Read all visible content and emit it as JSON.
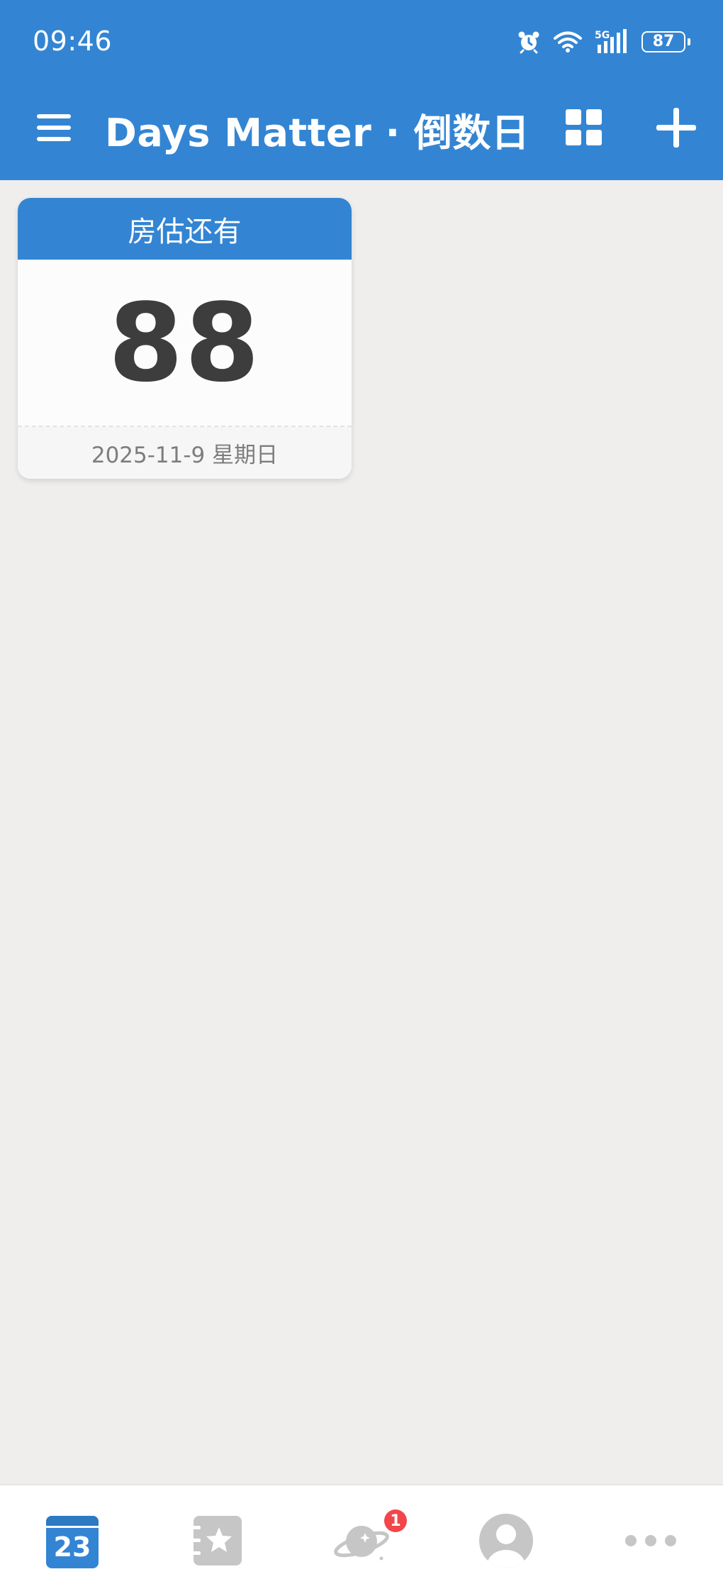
{
  "status_bar": {
    "time": "09:46",
    "network": "5G",
    "battery": "87"
  },
  "app_bar": {
    "title": "Days Matter · 倒数日",
    "menu_icon": "hamburger-menu-icon",
    "grid_icon": "grid-view-icon",
    "add_icon": "plus-icon"
  },
  "events": [
    {
      "title": "房估还有",
      "days": "88",
      "date": "2025-11-9 星期日"
    }
  ],
  "bottom_nav": {
    "items": [
      {
        "icon": "calendar-icon",
        "text": "23",
        "selected": true
      },
      {
        "icon": "star-book-icon"
      },
      {
        "icon": "planet-icon",
        "badge": "1"
      },
      {
        "icon": "profile-avatar-icon"
      },
      {
        "icon": "more-dots-icon"
      }
    ]
  },
  "colors": {
    "primary": "#3385d3",
    "background": "#efeeed",
    "card": "#fcfcfc",
    "badge": "#f2464b",
    "inactive_icon": "#c6c6c6"
  }
}
